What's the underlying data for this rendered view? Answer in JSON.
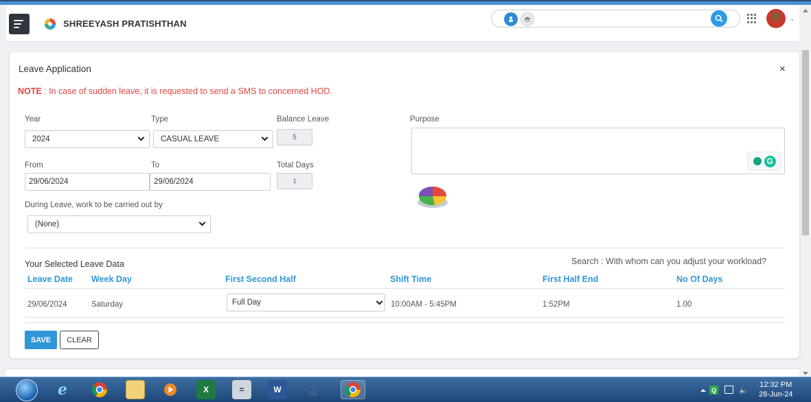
{
  "header": {
    "brand": "SHREEYASH PRATISHTHAN",
    "search_placeholder": ""
  },
  "modal": {
    "title": "Leave Application",
    "close": "×",
    "note_label": "NOTE",
    "note_text": " : In case of sudden leave, it is requested to send a SMS to concerned HOD."
  },
  "form": {
    "year_label": "Year",
    "year_value": "2024",
    "type_label": "Type",
    "type_value": "CASUAL LEAVE",
    "balance_label": "Balance Leave",
    "balance_value": "5",
    "purpose_label": "Purpose",
    "from_label": "From",
    "from_value": "29/06/2024",
    "to_label": "To",
    "to_value": "29/06/2024",
    "total_days_label": "Total Days",
    "total_days_value": "1",
    "carried_label": "During Leave, work to be carried out by",
    "carried_value": "(None)"
  },
  "leave_table": {
    "section_title": "Your Selected Leave Data",
    "search_note": "Search : With whom can you adjust your workload?",
    "headers": [
      "Leave Date",
      "Week Day",
      "First Second Half",
      "Shift Time",
      "First Half End",
      "No Of Days"
    ],
    "rows": [
      [
        "29/06/2024",
        "Saturday",
        "Full Day",
        "10:00AM - 5:45PM",
        "1:52PM",
        "1.00"
      ]
    ]
  },
  "actions": {
    "save": "SAVE",
    "clear": "CLEAR"
  },
  "taskbar": {
    "time": "12:32 PM",
    "date": "28-Jun-24"
  },
  "colors": {
    "accent_blue": "#2f97d8",
    "note_red": "#e0463f",
    "topbar_menu": "#2f3640",
    "taskbar": "#1d4678"
  }
}
